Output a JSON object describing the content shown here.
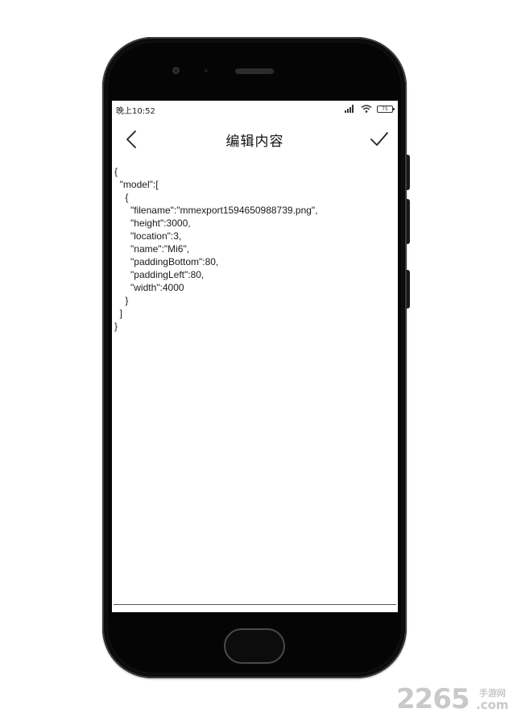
{
  "status_bar": {
    "time": "晚上10:52",
    "battery": "75"
  },
  "app_bar": {
    "title": "编辑内容",
    "back_icon": "chevron-left-icon",
    "confirm_icon": "check-icon"
  },
  "editor": {
    "content": "{\n  \"model\":[\n    {\n      \"filename\":\"mmexport1594650988739.png\",\n      \"height\":3000,\n      \"location\":3,\n      \"name\":\"Mi6\",\n      \"paddingBottom\":80,\n      \"paddingLeft\":80,\n      \"width\":4000\n    }\n  ]\n}"
  },
  "watermark": {
    "number": "2265",
    "site_cn": "手游网",
    "site_en": ".com"
  },
  "colors": {
    "phone_body": "#0f0f10",
    "screen_bg": "#ffffff",
    "text": "#1a1a1a",
    "watermark": "#c9c9c9"
  }
}
